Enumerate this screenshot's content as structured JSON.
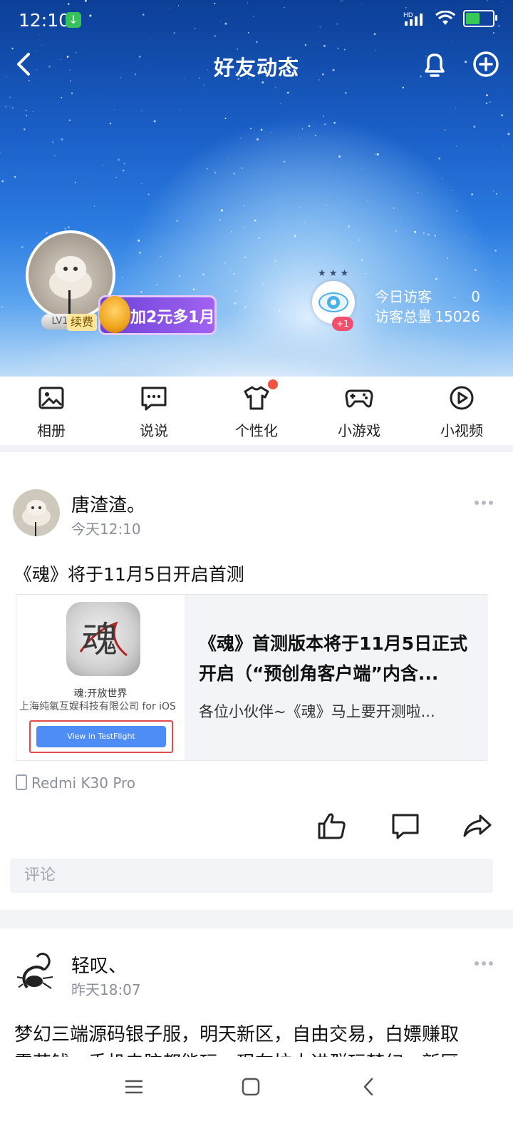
{
  "status_bar": {
    "time": "12:10",
    "network": "HD",
    "battery_level": 0.6
  },
  "header": {
    "title": "好友动态"
  },
  "profile": {
    "level": "LV1",
    "renew_label": "续费",
    "vip_promo": "加2元多1月",
    "visitor_plus": "+1",
    "today_label": "今日访客",
    "today_value": "0",
    "total_label": "访客总量",
    "total_value": "15026"
  },
  "quick_tabs": [
    {
      "label": "相册",
      "icon": "photo-album-icon"
    },
    {
      "label": "说说",
      "icon": "chat-bubble-icon"
    },
    {
      "label": "个性化",
      "icon": "tshirt-icon",
      "badge": true
    },
    {
      "label": "小游戏",
      "icon": "gamepad-icon"
    },
    {
      "label": "小视频",
      "icon": "play-circle-icon"
    }
  ],
  "posts": [
    {
      "author": "唐渣渣。",
      "time": "今天12:10",
      "text": "《魂》将于11月5日开启首测",
      "share": {
        "app_name": "魂:开放世界",
        "developer": "上海纯氧互娱科技有限公司 for iOS",
        "button": "View in TestFlight",
        "headline": "《魂》首测版本将于11月5日正式开启（“预创角客户端”内含...",
        "summary": "各位小伙伴~《魂》马上要开测啦..."
      },
      "device": "Redmi K30 Pro",
      "comment_placeholder": "评论"
    },
    {
      "author": "轻叹、",
      "time": "昨天18:07",
      "text": "梦幻三端源码银子服，明天新区，自由交易，白嫖赚取",
      "text2": "零花钱，手机电脑都能玩，现在拉人进群玩梦幻，新区"
    }
  ],
  "colors": {
    "accent_red": "#f05344",
    "vip_purple": "#7b4fe0",
    "testflight_blue": "#4d8df5",
    "muted_text": "#8b8f99"
  }
}
